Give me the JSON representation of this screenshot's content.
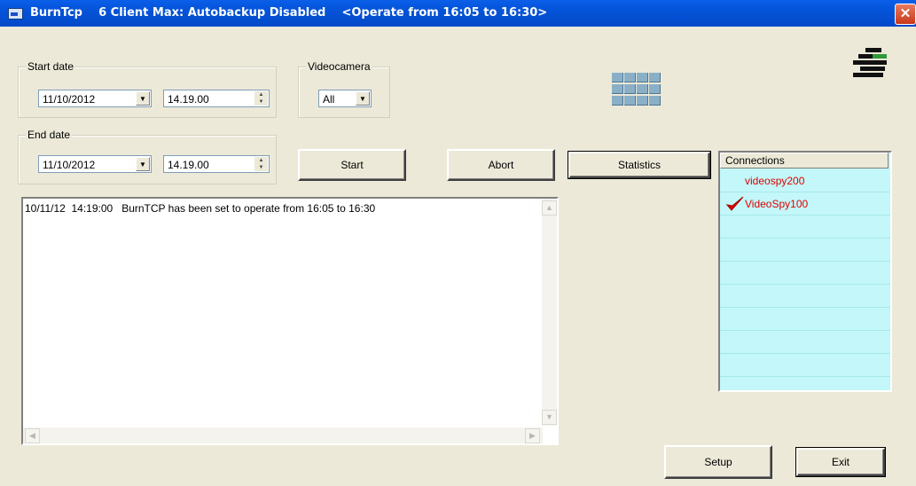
{
  "window": {
    "title": "BurnTcp    6 Client Max: Autobackup Disabled    <Operate from 16:05 to 16:30>",
    "close_glyph": "✕"
  },
  "start_date": {
    "label": "Start date",
    "date": "11/10/2012",
    "time": "14.19.00"
  },
  "end_date": {
    "label": "End date",
    "date": "11/10/2012",
    "time": "14.19.00"
  },
  "videocamera": {
    "label": "Videocamera",
    "selected": "All"
  },
  "buttons": {
    "start": "Start",
    "abort": "Abort",
    "statistics": "Statistics",
    "setup": "Setup",
    "exit": "Exit"
  },
  "log": {
    "lines": [
      "10/11/12  14:19:00   BurnTCP has been set to operate from 16:05 to 16:30"
    ]
  },
  "connections": {
    "header": "Connections",
    "items": [
      {
        "name": "videospy200",
        "checked": false
      },
      {
        "name": "VideoSpy100",
        "checked": true
      }
    ],
    "text_color": "#E00000",
    "bg_color": "#C3F7F9"
  },
  "icons": {
    "app": "app-window-icon",
    "grid": "camera-grid-icon",
    "logo": "brand-logo-icon",
    "check": "red-check-icon"
  }
}
